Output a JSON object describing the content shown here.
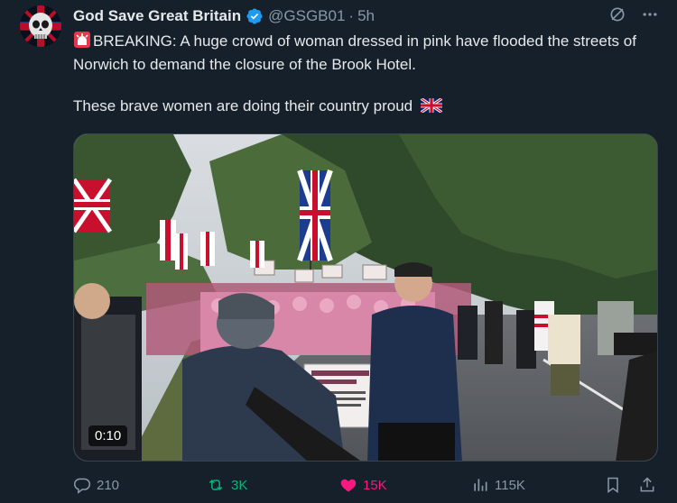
{
  "tweet": {
    "author_name": "God Save Great Britain",
    "handle": "@GSGB01",
    "separator": "·",
    "time": "5h",
    "text_line1": "BREAKING: A huge crowd of woman dressed in pink have flooded the streets of Norwich to demand the closure of the Brook Hotel.",
    "text_line2": "These brave women are doing their country proud",
    "video_duration": "0:10"
  },
  "stats": {
    "replies": "210",
    "retweets": "3K",
    "likes": "15K",
    "views": "115K"
  },
  "colors": {
    "background": "#15202b",
    "text": "#e7e9ea",
    "muted": "#8b98a5",
    "verified": "#1d9bf0",
    "retweet_active": "#00ba7c",
    "like_active": "#f91880"
  },
  "icons": {
    "siren": "siren-emoji-icon",
    "flag": "union-jack-flag-icon",
    "verified": "verified-badge-icon",
    "grok": "grok-icon",
    "more": "more-icon",
    "reply": "reply-icon",
    "retweet": "retweet-icon",
    "like": "heart-icon",
    "views": "views-icon",
    "bookmark": "bookmark-icon",
    "share": "share-icon"
  }
}
